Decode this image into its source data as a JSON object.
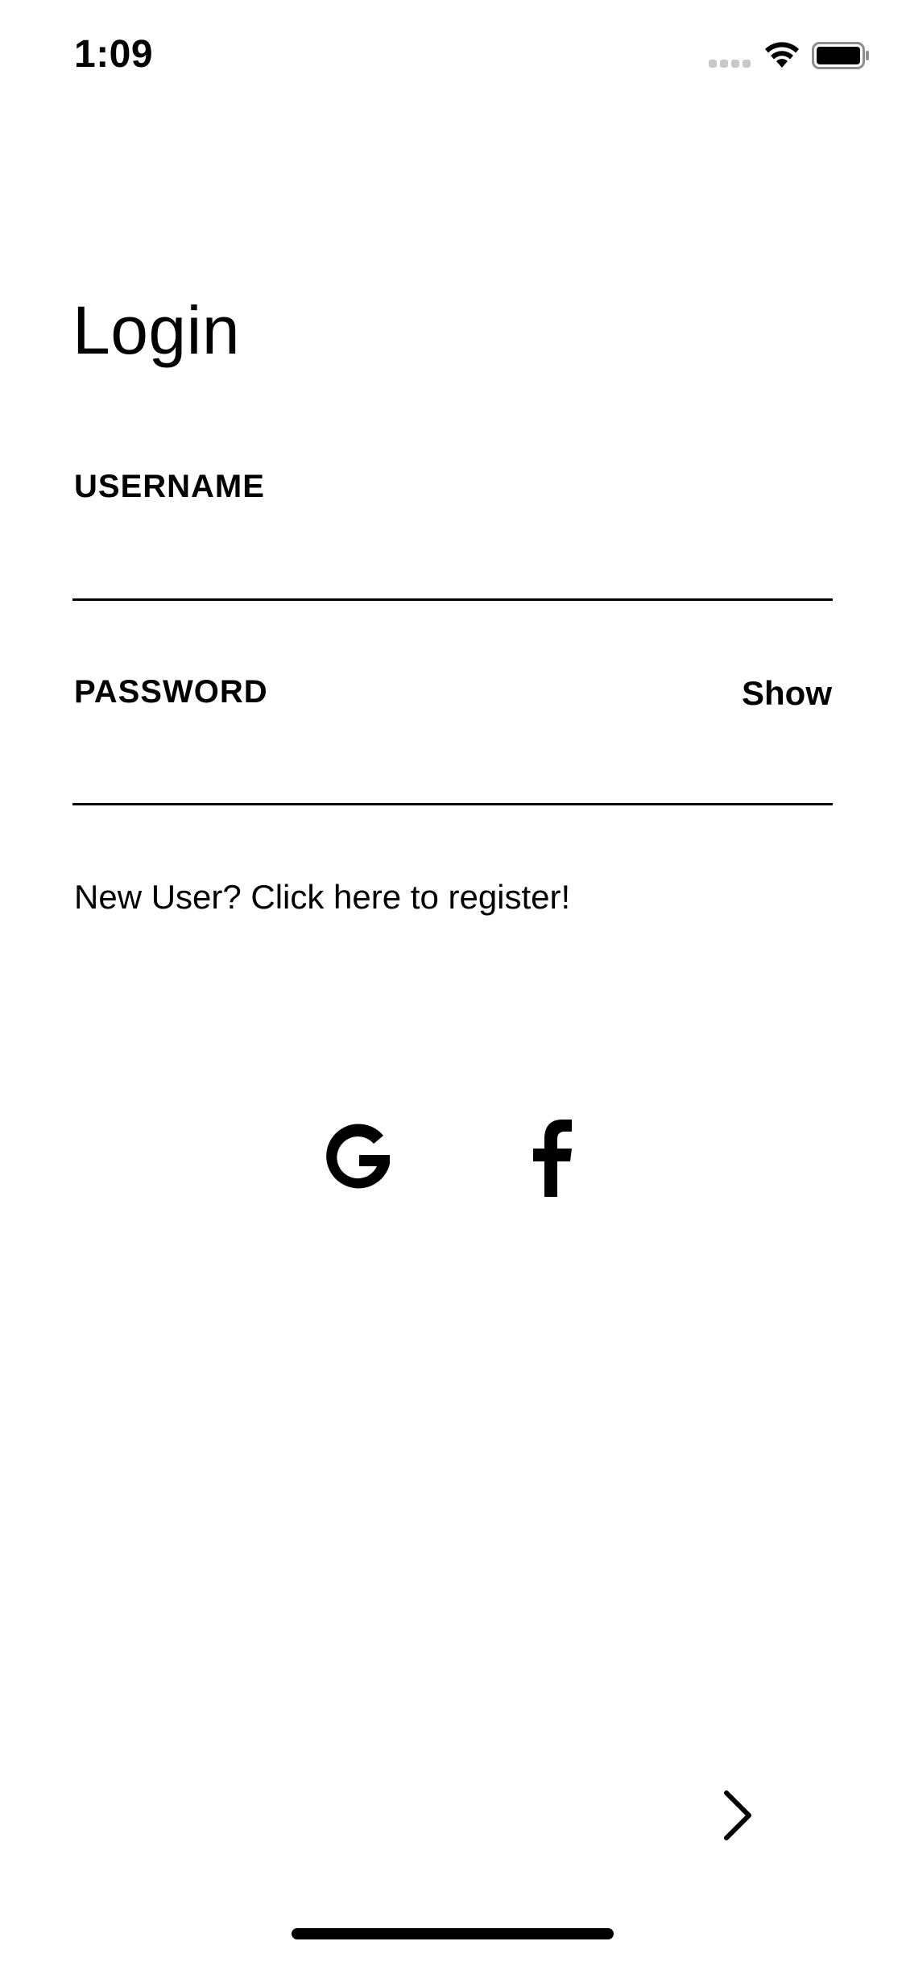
{
  "status_bar": {
    "time": "1:09"
  },
  "login": {
    "title": "Login",
    "username_label": "USERNAME",
    "username_value": "",
    "password_label": "PASSWORD",
    "password_value": "",
    "show_label": "Show",
    "register_text": "New User? Click here to register!"
  },
  "social": {
    "google_icon": "google-g-icon",
    "facebook_icon": "facebook-f-icon"
  },
  "navigation": {
    "next_icon": "chevron-right-icon"
  }
}
